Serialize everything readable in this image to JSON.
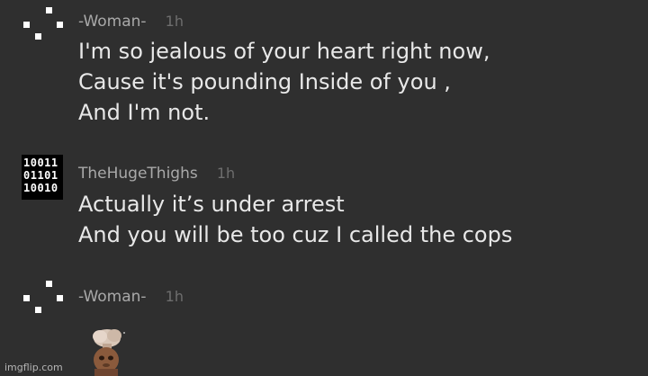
{
  "comments": [
    {
      "username": "-Woman-",
      "time": "1h",
      "lines": [
        "I'm so jealous of your heart right now,",
        "Cause it's pounding Inside of you ,",
        "And I'm not."
      ]
    },
    {
      "username": "TheHugeThighs",
      "time": "1h",
      "avatar_text": [
        "10011",
        "01101",
        "10010"
      ],
      "lines": [
        "Actually it’s under arrest",
        "And you will be too cuz I called the cops"
      ]
    },
    {
      "username": "-Woman-",
      "time": "1h",
      "lines": []
    }
  ],
  "watermark": "imgflip.com",
  "colors": {
    "background": "#2f2f2f",
    "username": "#a9a9a9",
    "time": "#6e6e6e",
    "body_text": "#e8e8e8"
  }
}
